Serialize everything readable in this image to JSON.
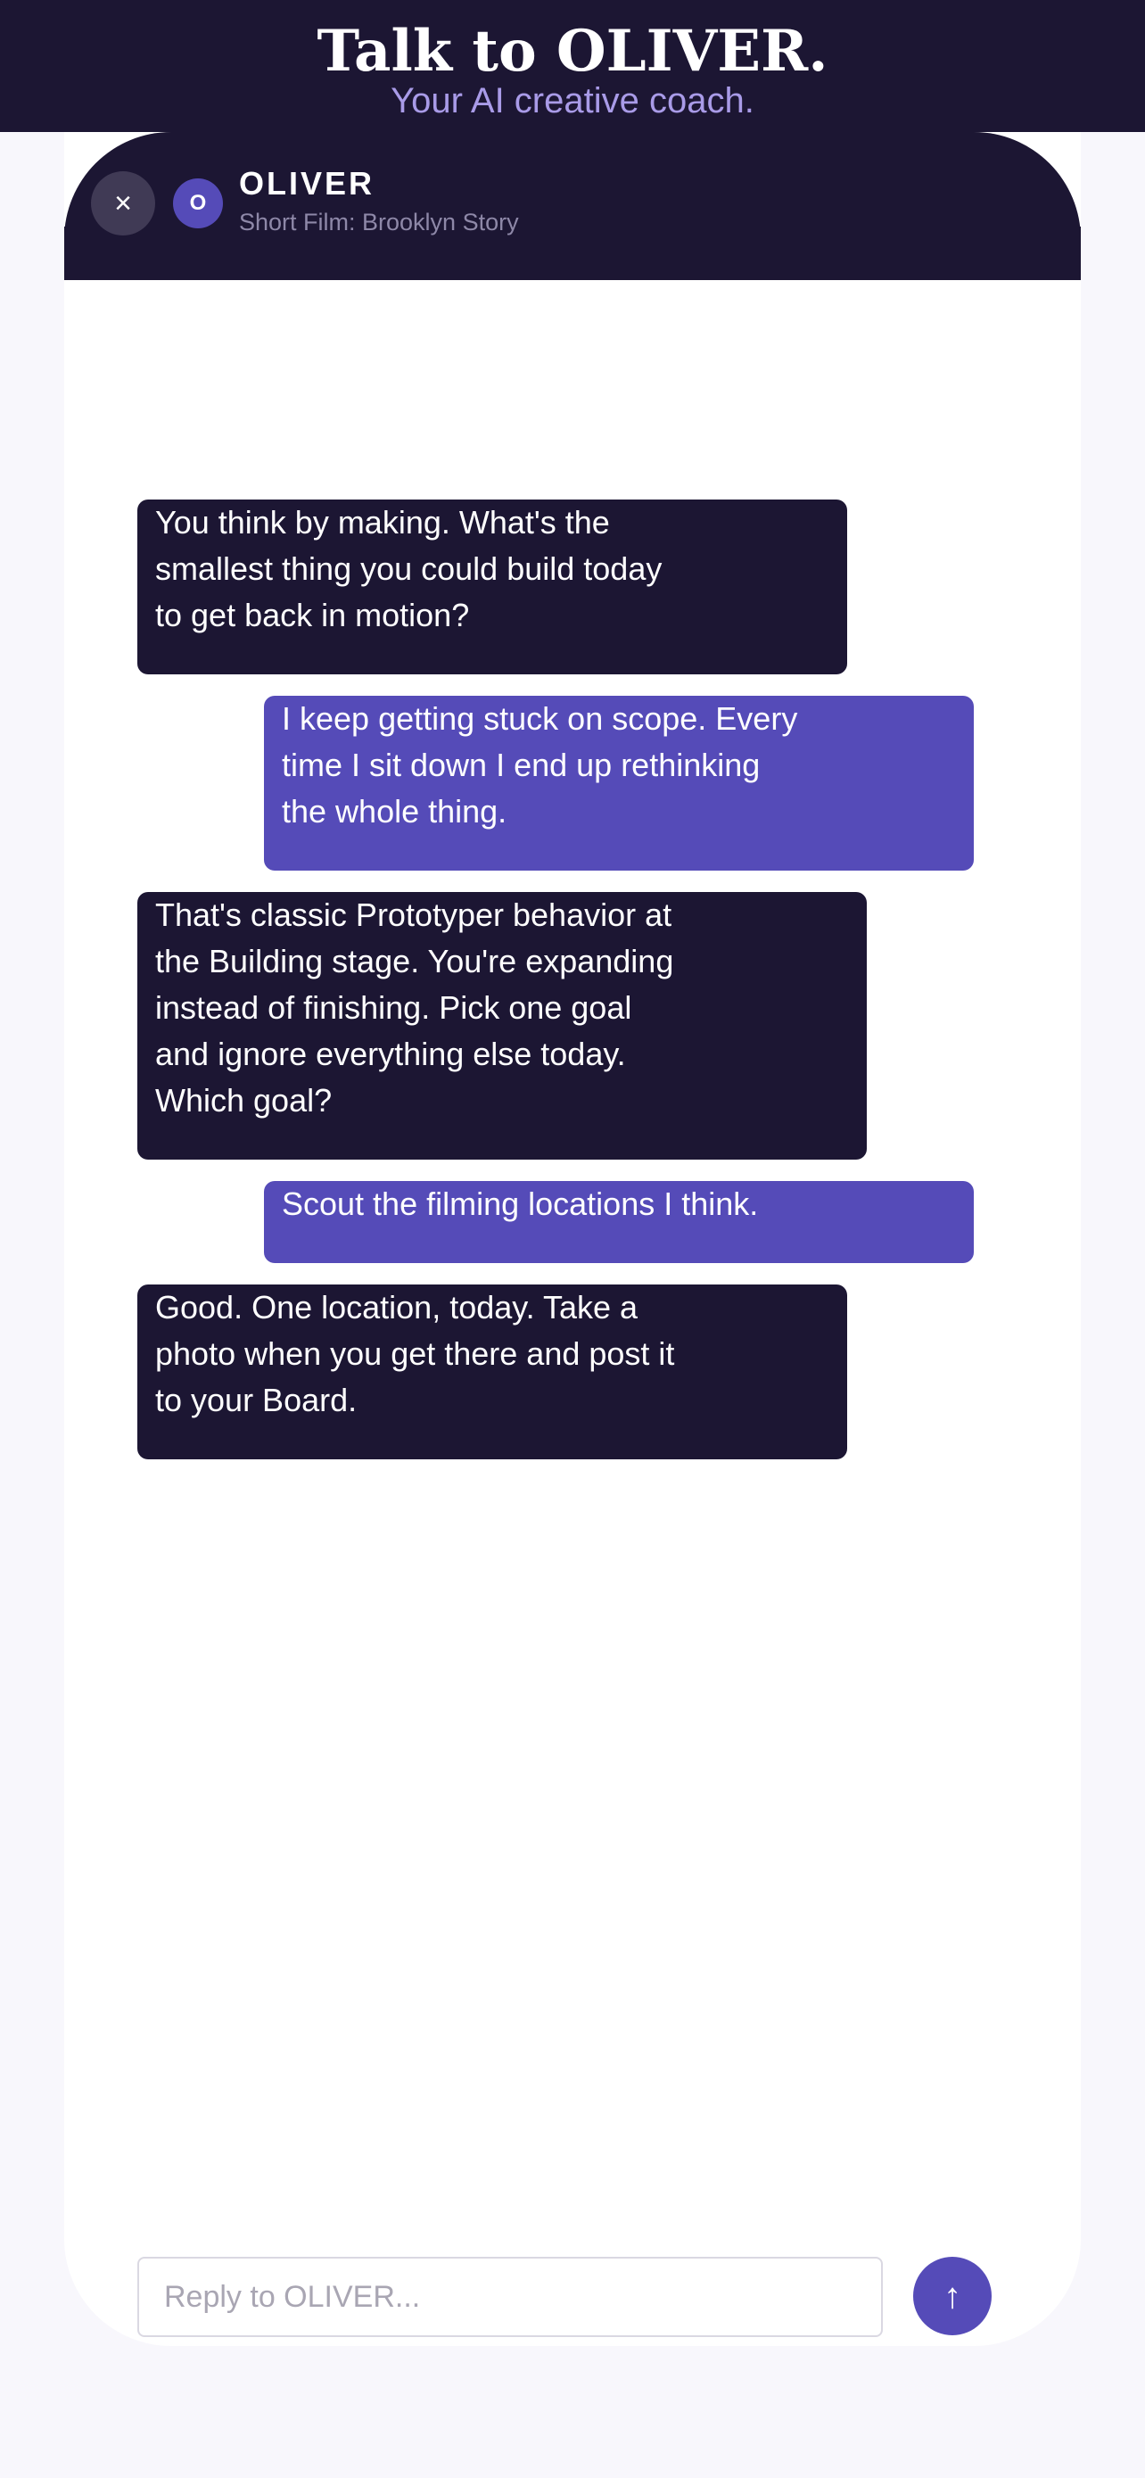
{
  "banner": {
    "title": "Talk to OLIVER.",
    "subtitle": "Your AI creative coach."
  },
  "header": {
    "close_icon": "×",
    "avatar_initial": "O",
    "coach_name": "OLIVER",
    "project": "Short Film: Brooklyn Story"
  },
  "messages": [
    {
      "sender": "coach",
      "text": "You think by making. What's the\nsmallest thing you could build today\nto get back in motion?"
    },
    {
      "sender": "user",
      "text": "I keep getting stuck on scope. Every\ntime I sit down I end up rethinking\nthe whole thing."
    },
    {
      "sender": "coach",
      "text": "That's classic Prototyper behavior at\nthe Building stage. You're expanding\ninstead of finishing. Pick one goal\nand ignore everything else today.\nWhich goal?"
    },
    {
      "sender": "user",
      "text": "Scout the filming locations I think."
    },
    {
      "sender": "coach",
      "text": "Good. One location, today. Take a\nphoto when you get there and post it\nto your Board."
    }
  ],
  "composer": {
    "placeholder": "Reply to OLIVER...",
    "value": "",
    "send_icon": "↑"
  },
  "colors": {
    "dark": "#1c1633",
    "accent": "#554bb8",
    "subtitle": "#a99be8",
    "background": "#f8f7fc"
  }
}
